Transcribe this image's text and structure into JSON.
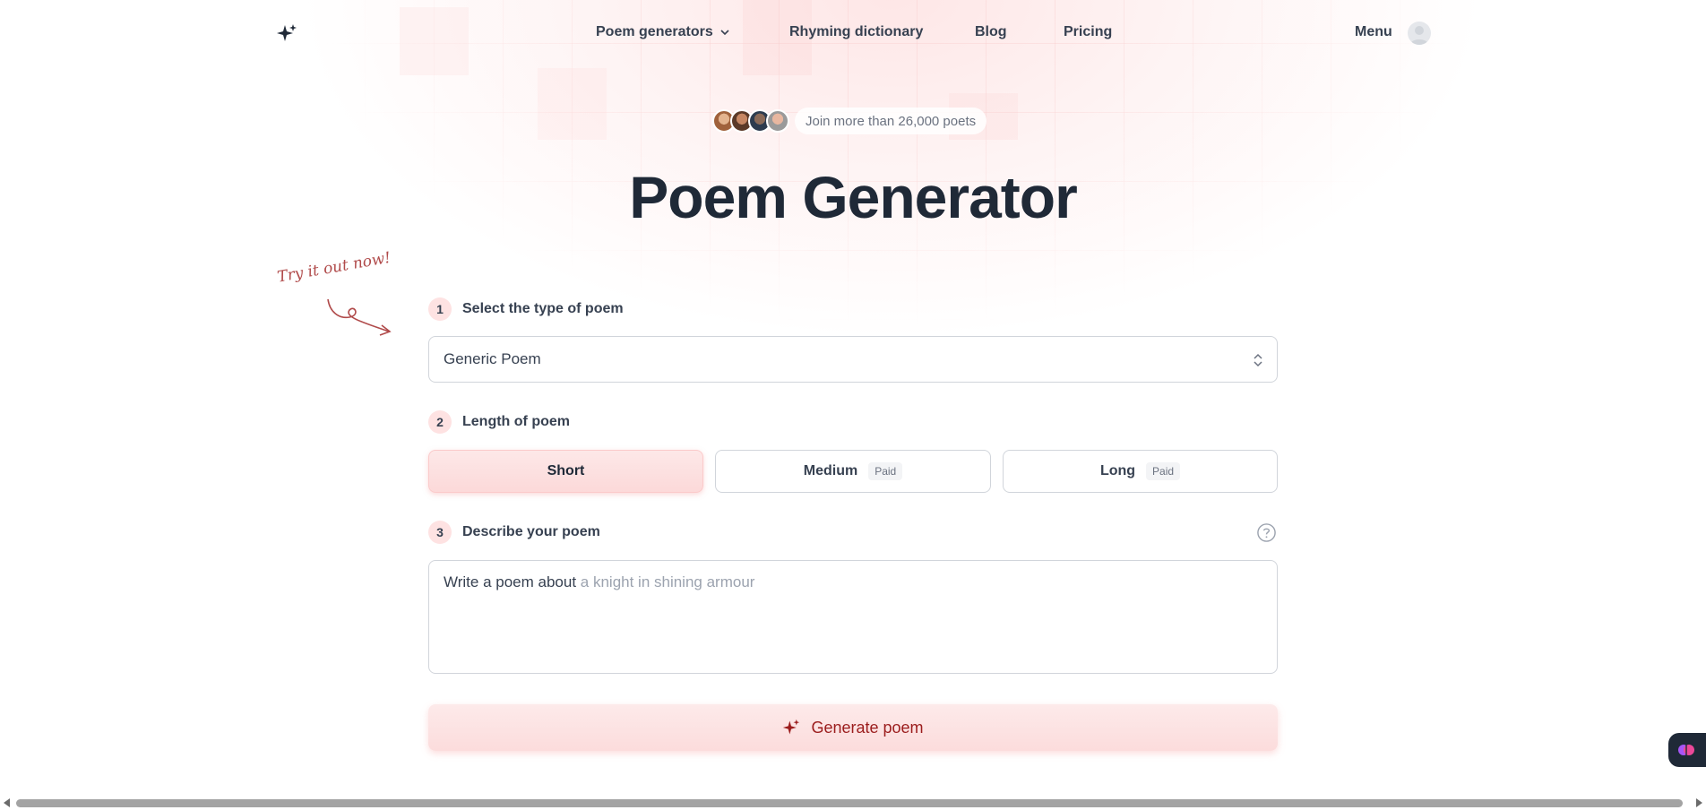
{
  "nav": {
    "items": [
      {
        "label": "Poem generators"
      },
      {
        "label": "Rhyming dictionary"
      },
      {
        "label": "Blog"
      },
      {
        "label": "Pricing"
      }
    ],
    "menu_label": "Menu"
  },
  "hero": {
    "social_proof": "Join more than 26,000 poets",
    "title": "Poem Generator",
    "hint": "Try it out now!"
  },
  "form": {
    "step1": {
      "number": "1",
      "label": "Select the type of poem",
      "selected": "Generic Poem"
    },
    "step2": {
      "number": "2",
      "label": "Length of poem",
      "options": [
        {
          "label": "Short",
          "badge": ""
        },
        {
          "label": "Medium",
          "badge": "Paid"
        },
        {
          "label": "Long",
          "badge": "Paid"
        }
      ]
    },
    "step3": {
      "number": "3",
      "label": "Describe your poem",
      "prefix": "Write a poem about",
      "placeholder": "a knight in shining armour"
    },
    "generate_label": "Generate poem"
  },
  "colors": {
    "accent": "#9b1c1c",
    "accent_bg": "#fde8e8",
    "text": "#1f2937"
  },
  "icons": [
    "sparkles-icon",
    "chevron-down-icon",
    "user-icon",
    "chevron-up-down-icon",
    "question-circle-icon",
    "brain-icon"
  ]
}
